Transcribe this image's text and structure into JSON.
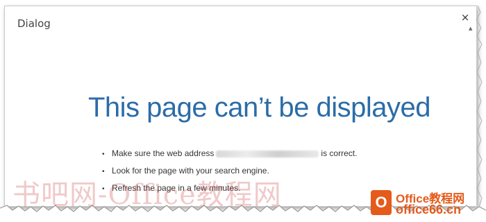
{
  "dialog": {
    "title": "Dialog",
    "close_glyph": "×",
    "heading": "This page can’t be displayed",
    "tips": [
      {
        "before": "Make sure the web address",
        "after": "is correct."
      },
      {
        "text": "Look for the page with your search engine."
      },
      {
        "text": "Refresh the page in a few minutes."
      }
    ],
    "bullet": "•"
  },
  "overlay": {
    "watermark_text": "书吧网-Office教程网",
    "logo_letter": "O",
    "logo_line1": "Office教程网",
    "logo_line2": "office66.cn"
  },
  "colors": {
    "heading": "#2b6ca8",
    "logo": "#e45b1b"
  },
  "icons": {
    "close": "close-icon",
    "bullet": "bullet-icon"
  }
}
